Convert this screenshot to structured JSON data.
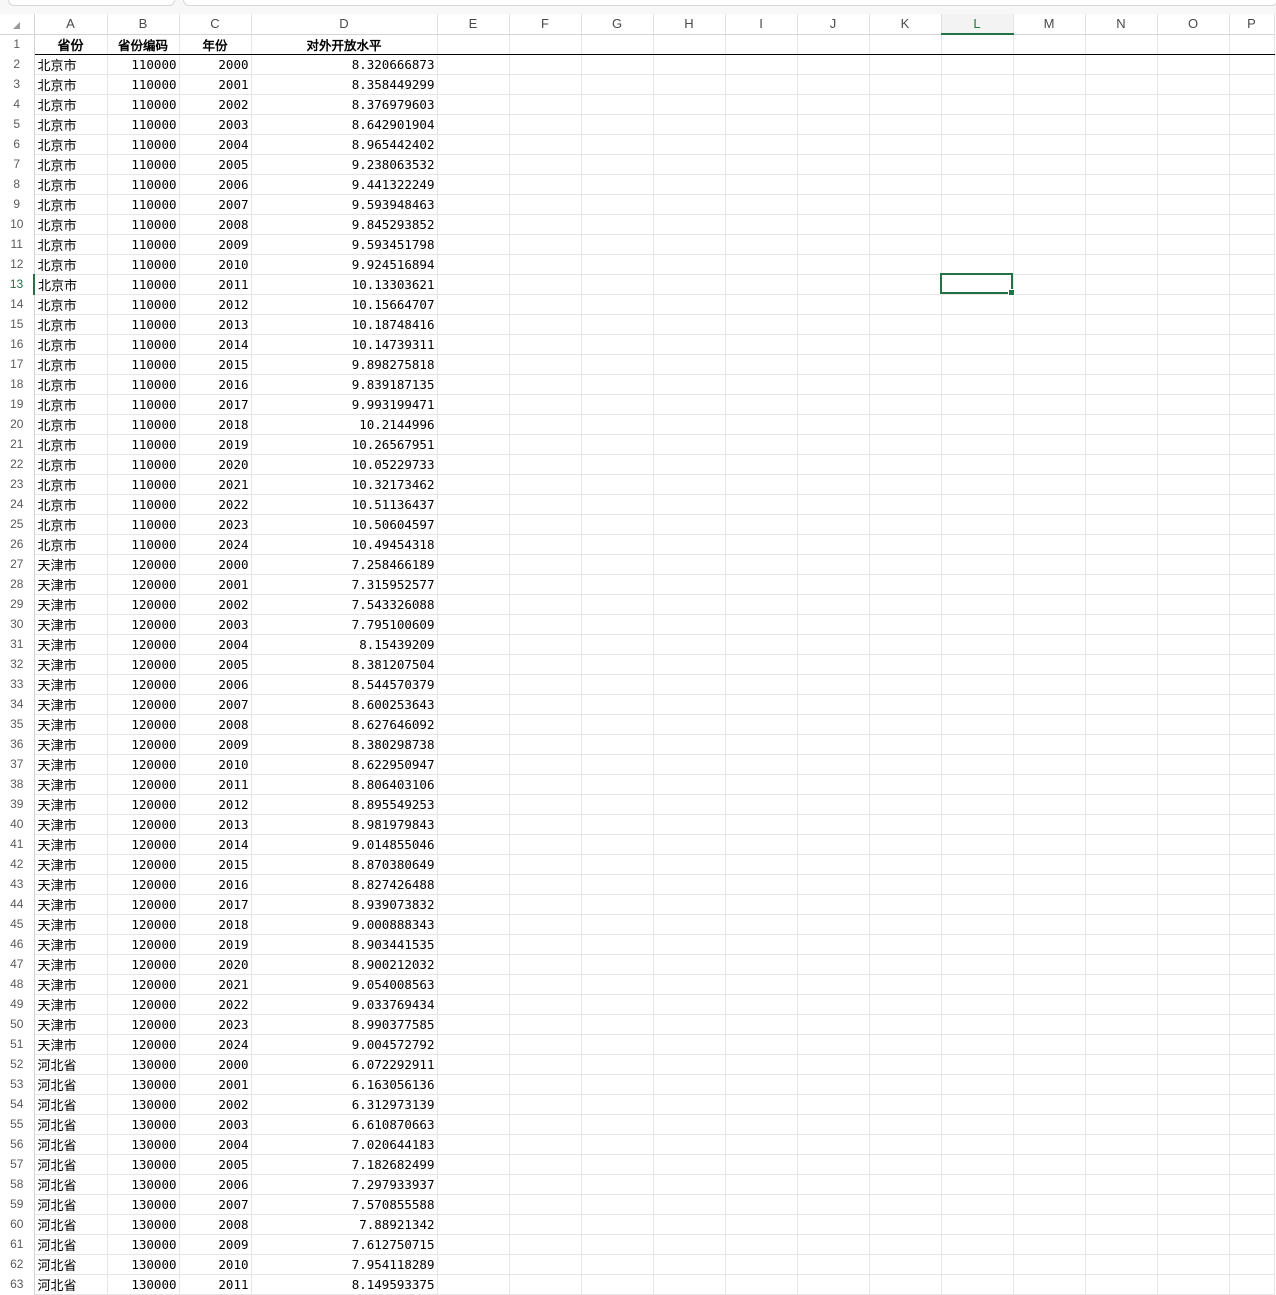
{
  "columns": [
    "A",
    "B",
    "C",
    "D",
    "E",
    "F",
    "G",
    "H",
    "I",
    "J",
    "K",
    "L",
    "M",
    "N",
    "O",
    "P"
  ],
  "active_column": "L",
  "active_row": 13,
  "header_row": [
    "省份",
    "省份编码",
    "年份",
    "对外开放水平"
  ],
  "rows": [
    [
      "北京市",
      "110000",
      "2000",
      "8.320666873"
    ],
    [
      "北京市",
      "110000",
      "2001",
      "8.358449299"
    ],
    [
      "北京市",
      "110000",
      "2002",
      "8.376979603"
    ],
    [
      "北京市",
      "110000",
      "2003",
      "8.642901904"
    ],
    [
      "北京市",
      "110000",
      "2004",
      "8.965442402"
    ],
    [
      "北京市",
      "110000",
      "2005",
      "9.238063532"
    ],
    [
      "北京市",
      "110000",
      "2006",
      "9.441322249"
    ],
    [
      "北京市",
      "110000",
      "2007",
      "9.593948463"
    ],
    [
      "北京市",
      "110000",
      "2008",
      "9.845293852"
    ],
    [
      "北京市",
      "110000",
      "2009",
      "9.593451798"
    ],
    [
      "北京市",
      "110000",
      "2010",
      "9.924516894"
    ],
    [
      "北京市",
      "110000",
      "2011",
      "10.13303621"
    ],
    [
      "北京市",
      "110000",
      "2012",
      "10.15664707"
    ],
    [
      "北京市",
      "110000",
      "2013",
      "10.18748416"
    ],
    [
      "北京市",
      "110000",
      "2014",
      "10.14739311"
    ],
    [
      "北京市",
      "110000",
      "2015",
      "9.898275818"
    ],
    [
      "北京市",
      "110000",
      "2016",
      "9.839187135"
    ],
    [
      "北京市",
      "110000",
      "2017",
      "9.993199471"
    ],
    [
      "北京市",
      "110000",
      "2018",
      "10.2144996"
    ],
    [
      "北京市",
      "110000",
      "2019",
      "10.26567951"
    ],
    [
      "北京市",
      "110000",
      "2020",
      "10.05229733"
    ],
    [
      "北京市",
      "110000",
      "2021",
      "10.32173462"
    ],
    [
      "北京市",
      "110000",
      "2022",
      "10.51136437"
    ],
    [
      "北京市",
      "110000",
      "2023",
      "10.50604597"
    ],
    [
      "北京市",
      "110000",
      "2024",
      "10.49454318"
    ],
    [
      "天津市",
      "120000",
      "2000",
      "7.258466189"
    ],
    [
      "天津市",
      "120000",
      "2001",
      "7.315952577"
    ],
    [
      "天津市",
      "120000",
      "2002",
      "7.543326088"
    ],
    [
      "天津市",
      "120000",
      "2003",
      "7.795100609"
    ],
    [
      "天津市",
      "120000",
      "2004",
      "8.15439209"
    ],
    [
      "天津市",
      "120000",
      "2005",
      "8.381207504"
    ],
    [
      "天津市",
      "120000",
      "2006",
      "8.544570379"
    ],
    [
      "天津市",
      "120000",
      "2007",
      "8.600253643"
    ],
    [
      "天津市",
      "120000",
      "2008",
      "8.627646092"
    ],
    [
      "天津市",
      "120000",
      "2009",
      "8.380298738"
    ],
    [
      "天津市",
      "120000",
      "2010",
      "8.622950947"
    ],
    [
      "天津市",
      "120000",
      "2011",
      "8.806403106"
    ],
    [
      "天津市",
      "120000",
      "2012",
      "8.895549253"
    ],
    [
      "天津市",
      "120000",
      "2013",
      "8.981979843"
    ],
    [
      "天津市",
      "120000",
      "2014",
      "9.014855046"
    ],
    [
      "天津市",
      "120000",
      "2015",
      "8.870380649"
    ],
    [
      "天津市",
      "120000",
      "2016",
      "8.827426488"
    ],
    [
      "天津市",
      "120000",
      "2017",
      "8.939073832"
    ],
    [
      "天津市",
      "120000",
      "2018",
      "9.000888343"
    ],
    [
      "天津市",
      "120000",
      "2019",
      "8.903441535"
    ],
    [
      "天津市",
      "120000",
      "2020",
      "8.900212032"
    ],
    [
      "天津市",
      "120000",
      "2021",
      "9.054008563"
    ],
    [
      "天津市",
      "120000",
      "2022",
      "9.033769434"
    ],
    [
      "天津市",
      "120000",
      "2023",
      "8.990377585"
    ],
    [
      "天津市",
      "120000",
      "2024",
      "9.004572792"
    ],
    [
      "河北省",
      "130000",
      "2000",
      "6.072292911"
    ],
    [
      "河北省",
      "130000",
      "2001",
      "6.163056136"
    ],
    [
      "河北省",
      "130000",
      "2002",
      "6.312973139"
    ],
    [
      "河北省",
      "130000",
      "2003",
      "6.610870663"
    ],
    [
      "河北省",
      "130000",
      "2004",
      "7.020644183"
    ],
    [
      "河北省",
      "130000",
      "2005",
      "7.182682499"
    ],
    [
      "河北省",
      "130000",
      "2006",
      "7.297933937"
    ],
    [
      "河北省",
      "130000",
      "2007",
      "7.570855588"
    ],
    [
      "河北省",
      "130000",
      "2008",
      "7.88921342"
    ],
    [
      "河北省",
      "130000",
      "2009",
      "7.612750715"
    ],
    [
      "河北省",
      "130000",
      "2010",
      "7.954118289"
    ],
    [
      "河北省",
      "130000",
      "2011",
      "8.149593375"
    ]
  ],
  "colors": {
    "accent": "#217346",
    "gridline": "#e6e6e6",
    "header_border": "#d4d4d4"
  }
}
